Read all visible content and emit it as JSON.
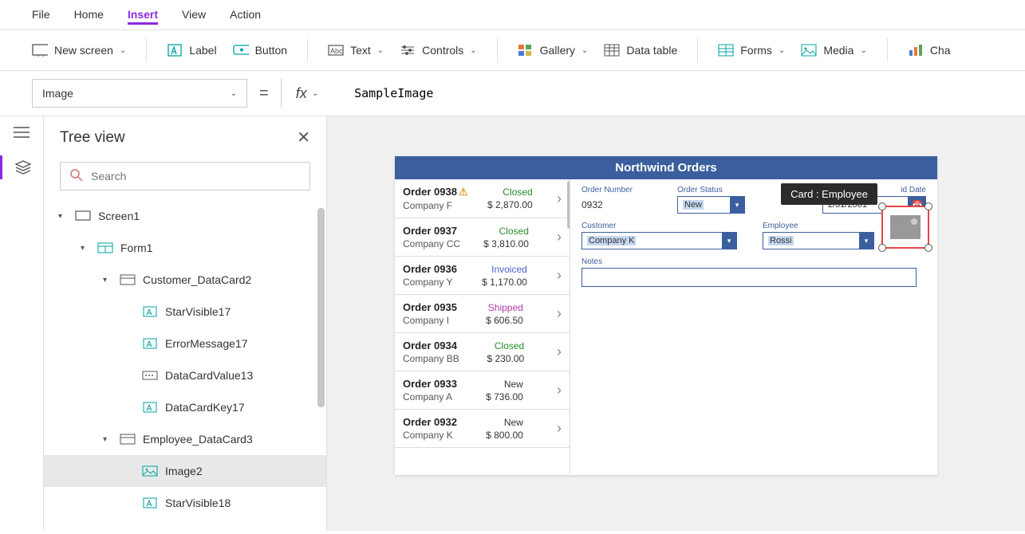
{
  "top_menu": {
    "file": "File",
    "home": "Home",
    "insert": "Insert",
    "view": "View",
    "action": "Action"
  },
  "ribbon": {
    "new_screen": "New screen",
    "label": "Label",
    "button": "Button",
    "text": "Text",
    "controls": "Controls",
    "gallery": "Gallery",
    "data_table": "Data table",
    "forms": "Forms",
    "media": "Media",
    "chart": "Cha"
  },
  "formula": {
    "property": "Image",
    "value": "SampleImage"
  },
  "tree": {
    "title": "Tree view",
    "search_placeholder": "Search",
    "nodes": [
      {
        "name": "Screen1",
        "icon": "screen",
        "indent": 0,
        "caret": "▾"
      },
      {
        "name": "Form1",
        "icon": "form",
        "indent": 1,
        "caret": "▾"
      },
      {
        "name": "Customer_DataCard2",
        "icon": "card",
        "indent": 2,
        "caret": "▾"
      },
      {
        "name": "StarVisible17",
        "icon": "label",
        "indent": 3,
        "caret": ""
      },
      {
        "name": "ErrorMessage17",
        "icon": "label",
        "indent": 3,
        "caret": ""
      },
      {
        "name": "DataCardValue13",
        "icon": "input",
        "indent": 3,
        "caret": ""
      },
      {
        "name": "DataCardKey17",
        "icon": "label",
        "indent": 3,
        "caret": ""
      },
      {
        "name": "Employee_DataCard3",
        "icon": "card",
        "indent": 2,
        "caret": "▾"
      },
      {
        "name": "Image2",
        "icon": "image",
        "indent": 3,
        "caret": "",
        "selected": true
      },
      {
        "name": "StarVisible18",
        "icon": "label",
        "indent": 3,
        "caret": ""
      }
    ]
  },
  "app": {
    "title": "Northwind Orders",
    "orders": [
      {
        "num": "Order 0938",
        "company": "Company F",
        "status": "Closed",
        "amount": "$ 2,870.00",
        "warn": true
      },
      {
        "num": "Order 0937",
        "company": "Company CC",
        "status": "Closed",
        "amount": "$ 3,810.00"
      },
      {
        "num": "Order 0936",
        "company": "Company Y",
        "status": "Invoiced",
        "amount": "$ 1,170.00"
      },
      {
        "num": "Order 0935",
        "company": "Company I",
        "status": "Shipped",
        "amount": "$ 606.50"
      },
      {
        "num": "Order 0934",
        "company": "Company BB",
        "status": "Closed",
        "amount": "$ 230.00"
      },
      {
        "num": "Order 0933",
        "company": "Company A",
        "status": "New",
        "amount": "$ 736.00"
      },
      {
        "num": "Order 0932",
        "company": "Company K",
        "status": "New",
        "amount": "$ 800.00"
      }
    ],
    "form": {
      "order_number_label": "Order Number",
      "order_number_value": "0932",
      "order_status_label": "Order Status",
      "order_status_value": "New",
      "paid_date_label": "id Date",
      "paid_date_value": "2/31/2001",
      "customer_label": "Customer",
      "customer_value": "Company K",
      "employee_label": "Employee",
      "employee_value": "Rossi",
      "notes_label": "Notes"
    },
    "tooltip": "Card : Employee"
  }
}
